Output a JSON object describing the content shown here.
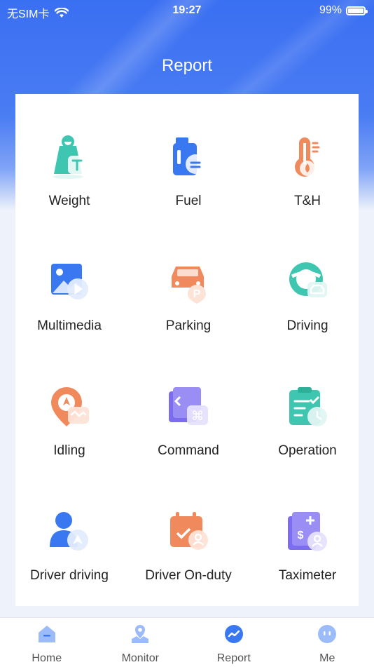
{
  "status_bar": {
    "carrier": "无SIM卡",
    "time": "19:27",
    "battery_percent": "99%",
    "battery_level": 0.99
  },
  "header": {
    "title": "Report"
  },
  "reports": [
    {
      "label": "Weight",
      "icon": "weight-icon",
      "color": "#3fc6b0"
    },
    {
      "label": "Fuel",
      "icon": "fuel-icon",
      "color": "#3a78f2"
    },
    {
      "label": "T&H",
      "icon": "thermometer-icon",
      "color": "#f08a5d"
    },
    {
      "label": "Multimedia",
      "icon": "multimedia-icon",
      "color": "#3a78f2"
    },
    {
      "label": "Parking",
      "icon": "parking-icon",
      "color": "#f08a5d"
    },
    {
      "label": "Driving",
      "icon": "steering-wheel-icon",
      "color": "#3fc6b0"
    },
    {
      "label": "Idling",
      "icon": "idling-icon",
      "color": "#f08a5d"
    },
    {
      "label": "Command",
      "icon": "command-icon",
      "color": "#7b6cf0"
    },
    {
      "label": "Operation",
      "icon": "operation-icon",
      "color": "#3fc6b0"
    },
    {
      "label": "Driver driving",
      "icon": "driver-driving-icon",
      "color": "#3a78f2"
    },
    {
      "label": "Driver On-duty",
      "icon": "driver-on-duty-icon",
      "color": "#f08a5d"
    },
    {
      "label": "Taximeter",
      "icon": "taximeter-icon",
      "color": "#7b6cf0"
    }
  ],
  "tabbar": [
    {
      "label": "Home",
      "icon": "home-icon",
      "active": false
    },
    {
      "label": "Monitor",
      "icon": "map-pin-icon",
      "active": false
    },
    {
      "label": "Report",
      "icon": "report-chart-icon",
      "active": true
    },
    {
      "label": "Me",
      "icon": "me-face-icon",
      "active": false
    }
  ]
}
